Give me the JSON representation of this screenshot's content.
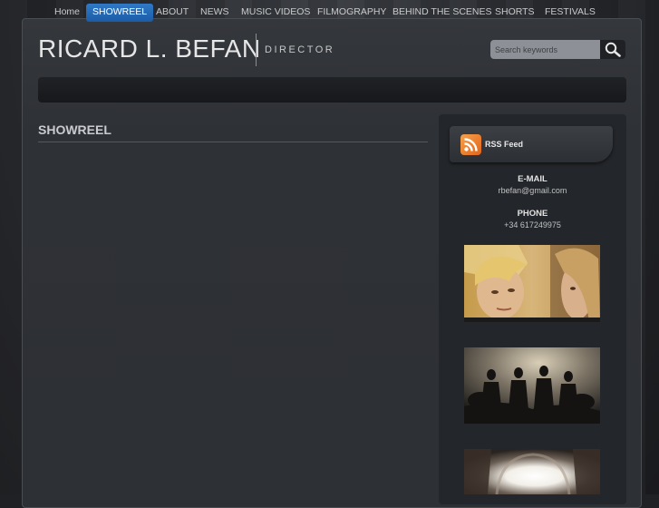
{
  "header": {
    "title": "RICARD L. BEFAN",
    "tagline": "DIRECTOR"
  },
  "search": {
    "placeholder": "Search keywords"
  },
  "nav": {
    "items": [
      {
        "label": "Home",
        "active": false
      },
      {
        "label": "SHOWREEL",
        "active": true
      },
      {
        "label": "ABOUT",
        "active": false
      },
      {
        "label": "NEWS",
        "active": false
      },
      {
        "label": "MUSIC VIDEOS",
        "active": false
      },
      {
        "label": "FILMOGRAPHY",
        "active": false
      },
      {
        "label": "BEHIND THE SCENES",
        "active": false
      },
      {
        "label": "SHORTS",
        "active": false
      },
      {
        "label": "FESTIVALS",
        "active": false
      }
    ]
  },
  "main": {
    "section_title": "SHOWREEL"
  },
  "sidebar": {
    "rss_label": "RSS Feed",
    "email_label": "E-MAIL",
    "email_value": "rbefan@gmail.com",
    "phone_label": "PHONE",
    "phone_value": "+34 617249975",
    "thumbnails": [
      "film-still-faces",
      "film-still-dancers",
      "film-still-light"
    ]
  },
  "colors": {
    "accent": "#2f79c6",
    "rss": "#e1641a",
    "background": "#2e3136"
  }
}
